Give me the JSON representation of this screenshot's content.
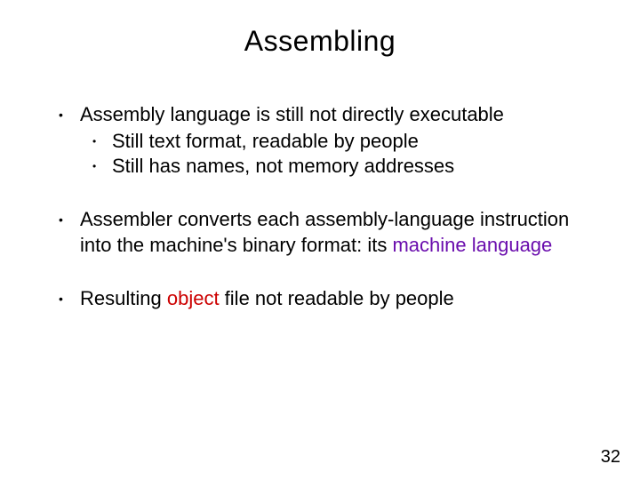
{
  "title": "Assembling",
  "bullets": {
    "b1": {
      "text": "Assembly language is still not directly executable",
      "sub": {
        "s1": "Still text format, readable by people",
        "s2": "Still has names, not memory addresses"
      }
    },
    "b2": {
      "pre": "Assembler converts each assembly-language instruction into the machine's binary format: its ",
      "kw": "machine language"
    },
    "b3": {
      "pre": "Resulting ",
      "kw": "object",
      "post": " file not readable by people"
    }
  },
  "page_number": "32"
}
